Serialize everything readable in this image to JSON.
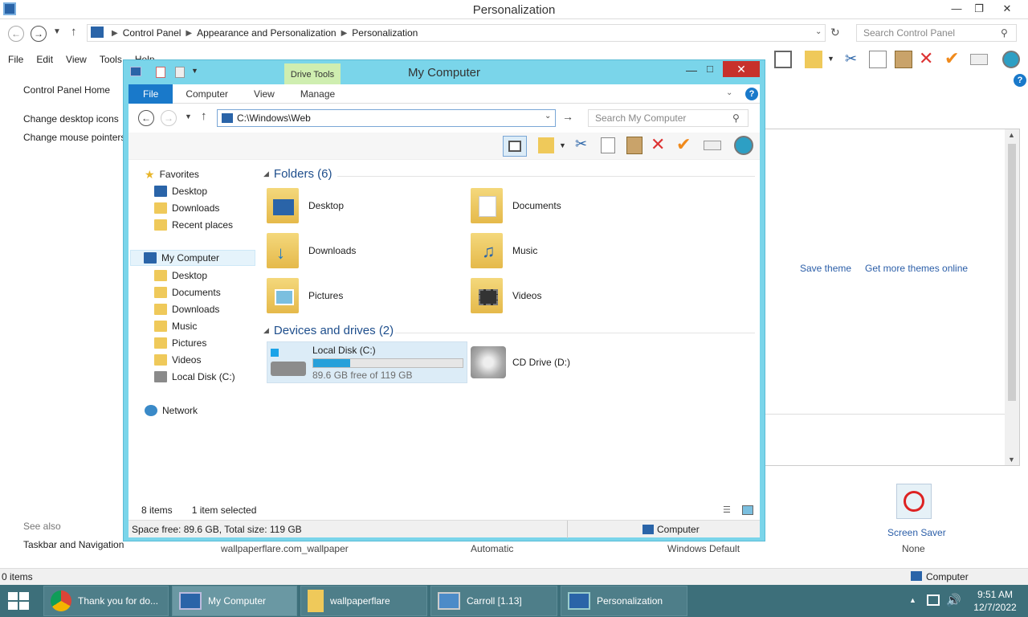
{
  "bg": {
    "title": "Personalization",
    "breadcrumb": [
      "Control Panel",
      "Appearance and Personalization",
      "Personalization"
    ],
    "search_placeholder": "Search Control Panel",
    "menu": [
      "File",
      "Edit",
      "View",
      "Tools",
      "Help"
    ],
    "side_links": [
      "Control Panel Home",
      "Change desktop icons",
      "Change mouse pointers"
    ],
    "see_also": "See also",
    "taskbar_nav": "Taskbar and Navigation",
    "save_theme": "Save theme",
    "get_more": "Get more themes online",
    "footer_items": [
      "wallpaperflare.com_wallpaper",
      "Automatic",
      "Windows Default"
    ],
    "screen_saver": "Screen Saver",
    "screen_saver_value": "None",
    "status_items": "0 items",
    "status_computer": "Computer"
  },
  "mc": {
    "title": "My Computer",
    "drive_tools": "Drive Tools",
    "tabs": [
      "File",
      "Computer",
      "View",
      "Manage"
    ],
    "address": "C:\\Windows\\Web",
    "search_placeholder": "Search My Computer",
    "nav": {
      "favorites": "Favorites",
      "fav_items": [
        "Desktop",
        "Downloads",
        "Recent places"
      ],
      "computer": "My Computer",
      "comp_items": [
        "Desktop",
        "Documents",
        "Downloads",
        "Music",
        "Pictures",
        "Videos",
        "Local Disk (C:)"
      ],
      "network": "Network"
    },
    "folders_header": "Folders (6)",
    "folders": [
      "Desktop",
      "Documents",
      "Downloads",
      "Music",
      "Pictures",
      "Videos"
    ],
    "devices_header": "Devices and drives (2)",
    "local_disk": {
      "name": "Local Disk (C:)",
      "free": "89.6 GB free of 119 GB",
      "used_fraction": 0.247
    },
    "cd_drive": "CD Drive (D:)",
    "status_items": "8 items",
    "status_selected": "1 item selected",
    "status_space": "Space free: 89.6 GB, Total size: 119 GB",
    "status_computer": "Computer"
  },
  "taskbar": {
    "tasks": [
      "Thank you for do...",
      "My Computer",
      "wallpaperflare",
      "Carroll [1.13]",
      "Personalization"
    ],
    "time": "9:51 AM",
    "date": "12/7/2022"
  }
}
